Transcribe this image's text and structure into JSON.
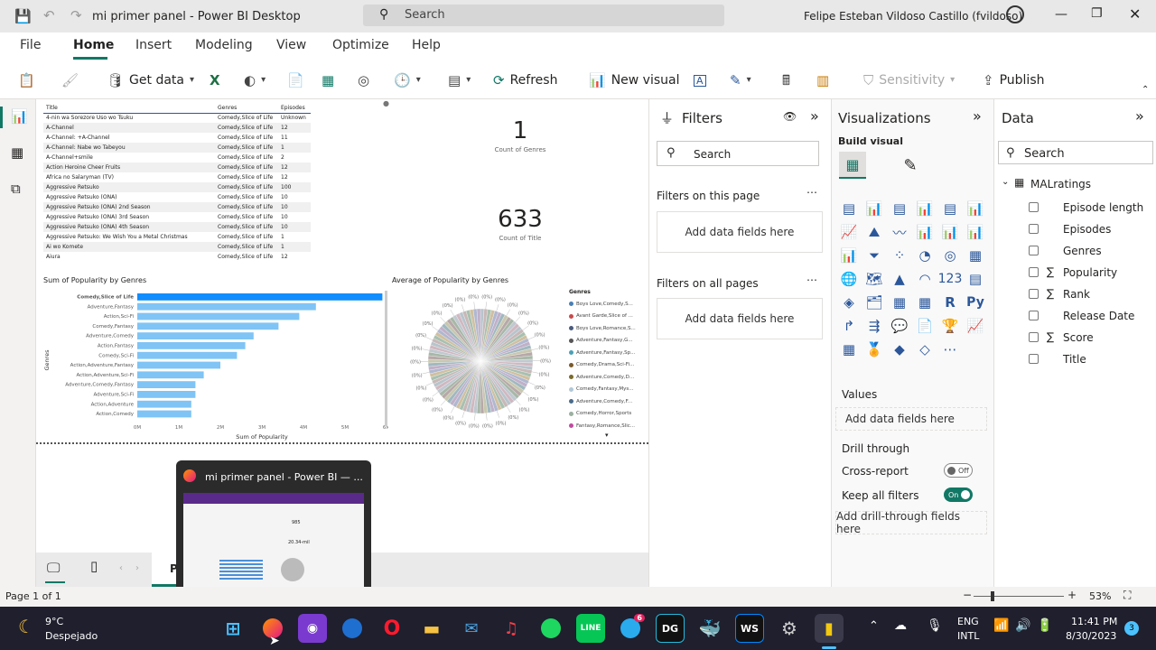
{
  "window": {
    "title": "mi primer panel - Power BI Desktop",
    "search_placeholder": "Search",
    "user": "Felipe Esteban Vildoso Castillo (fvildoso)"
  },
  "ribbon_tabs": [
    "File",
    "Home",
    "Insert",
    "Modeling",
    "View",
    "Optimize",
    "Help"
  ],
  "ribbon": {
    "get_data": "Get data",
    "refresh": "Refresh",
    "new_visual": "New visual",
    "sensitivity": "Sensitivity",
    "publish": "Publish"
  },
  "table_visual": {
    "headers": [
      "Title",
      "Genres",
      "Episodes"
    ],
    "rows": [
      [
        "4-nin wa Sorezore Uso wo Tsuku",
        "Comedy,Slice of Life",
        "Unknown"
      ],
      [
        "A-Channel",
        "Comedy,Slice of Life",
        "12"
      ],
      [
        "A-Channel: +A-Channel",
        "Comedy,Slice of Life",
        "11"
      ],
      [
        "A-Channel: Nabe wo Tabeyou",
        "Comedy,Slice of Life",
        "1"
      ],
      [
        "A-Channel+smile",
        "Comedy,Slice of Life",
        "2"
      ],
      [
        "Action Heroine Cheer Fruits",
        "Comedy,Slice of Life",
        "12"
      ],
      [
        "Africa no Salaryman (TV)",
        "Comedy,Slice of Life",
        "12"
      ],
      [
        "Aggressive Retsuko",
        "Comedy,Slice of Life",
        "100"
      ],
      [
        "Aggressive Retsuko (ONA)",
        "Comedy,Slice of Life",
        "10"
      ],
      [
        "Aggressive Retsuko (ONA) 2nd Season",
        "Comedy,Slice of Life",
        "10"
      ],
      [
        "Aggressive Retsuko (ONA) 3rd Season",
        "Comedy,Slice of Life",
        "10"
      ],
      [
        "Aggressive Retsuko (ONA) 4th Season",
        "Comedy,Slice of Life",
        "10"
      ],
      [
        "Aggressive Retsuko: We Wish You a Metal Christmas",
        "Comedy,Slice of Life",
        "1"
      ],
      [
        "Ai wo Komete",
        "Comedy,Slice of Life",
        "1"
      ],
      [
        "Aiura",
        "Comedy,Slice of Life",
        "12"
      ]
    ]
  },
  "cards": [
    {
      "value": "1",
      "label": "Count of Genres"
    },
    {
      "value": "633",
      "label": "Count of Title"
    }
  ],
  "chart_data": [
    {
      "type": "bar",
      "title": "Sum of Popularity by Genres",
      "xlabel": "Sum of Popularity",
      "ylabel": "Genres",
      "categories": [
        "Comedy,Slice of Life",
        "Adventure,Fantasy",
        "Action,Sci-Fi",
        "Comedy,Fantasy",
        "Adventure,Comedy",
        "Action,Fantasy",
        "Comedy,Sci-Fi",
        "Action,Adventure,Fantasy",
        "Action,Adventure,Sci-Fi",
        "Adventure,Comedy,Fantasy",
        "Adventure,Sci-Fi",
        "Action,Adventure",
        "Action,Comedy"
      ],
      "values": [
        5.9,
        4.3,
        3.9,
        3.4,
        2.8,
        2.6,
        2.4,
        2.0,
        1.6,
        1.4,
        1.4,
        1.3,
        1.3
      ],
      "xticks": [
        "0M",
        "1M",
        "2M",
        "3M",
        "4M",
        "5M",
        "6M"
      ],
      "xlim": [
        0,
        6
      ],
      "highlight_color": "#118dff",
      "bar_color": "#7fc4f5"
    },
    {
      "type": "pie",
      "title": "Average of Popularity by Genres",
      "legend_title": "Genres",
      "slice_label": "(0%)",
      "legend": [
        {
          "name": "Boys Love,Comedy,S...",
          "color": "#4a7fb5"
        },
        {
          "name": "Avant Garde,Slice of ...",
          "color": "#c94a4a"
        },
        {
          "name": "Boys Love,Romance,S...",
          "color": "#4a5a7a"
        },
        {
          "name": "Adventure,Fantasy,G...",
          "color": "#555555"
        },
        {
          "name": "Adventure,Fantasy,Sp...",
          "color": "#4aa0b5"
        },
        {
          "name": "Comedy,Drama,Sci-Fi...",
          "color": "#7a5a2a"
        },
        {
          "name": "Adventure,Comedy,D...",
          "color": "#7a6a2a"
        },
        {
          "name": "Comedy,Fantasy,Mys...",
          "color": "#b0c8d8"
        },
        {
          "name": "Adventure,Comedy,F...",
          "color": "#4a6a8a"
        },
        {
          "name": "Comedy,Horror,Sports",
          "color": "#9ab0a0"
        },
        {
          "name": "Fantasy,Romance,Slic...",
          "color": "#c04aa0"
        }
      ]
    }
  ],
  "page_tab": "P",
  "filters": {
    "title": "Filters",
    "search": "Search",
    "on_page": "Filters on this page",
    "on_all": "Filters on all pages",
    "add": "Add data fields here"
  },
  "visualizations": {
    "title": "Visualizations",
    "build": "Build visual",
    "values": "Values",
    "add": "Add data fields here",
    "drill": "Drill through",
    "cross": "Cross-report",
    "cross_state": "Off",
    "keep": "Keep all filters",
    "keep_state": "On",
    "add_drill": "Add drill-through fields here"
  },
  "data_pane": {
    "title": "Data",
    "search": "Search",
    "table": "MALratings",
    "fields": [
      {
        "name": "Episode length",
        "sigma": false
      },
      {
        "name": "Episodes",
        "sigma": false
      },
      {
        "name": "Genres",
        "sigma": false
      },
      {
        "name": "Popularity",
        "sigma": true
      },
      {
        "name": "Rank",
        "sigma": true
      },
      {
        "name": "Release Date",
        "sigma": false
      },
      {
        "name": "Score",
        "sigma": true
      },
      {
        "name": "Title",
        "sigma": false
      }
    ]
  },
  "thumbnail": {
    "title": "mi primer panel - Power BI — ...",
    "card1": "985",
    "card2": "20.34-mil"
  },
  "status": {
    "page": "Page 1 of 1",
    "zoom": "53%"
  },
  "taskbar": {
    "temp": "9°C",
    "weather": "Despejado",
    "lang1": "ENG",
    "lang2": "INTL",
    "time": "11:41 PM",
    "date": "8/30/2023",
    "badge": "3",
    "telegram_badge": "6"
  }
}
